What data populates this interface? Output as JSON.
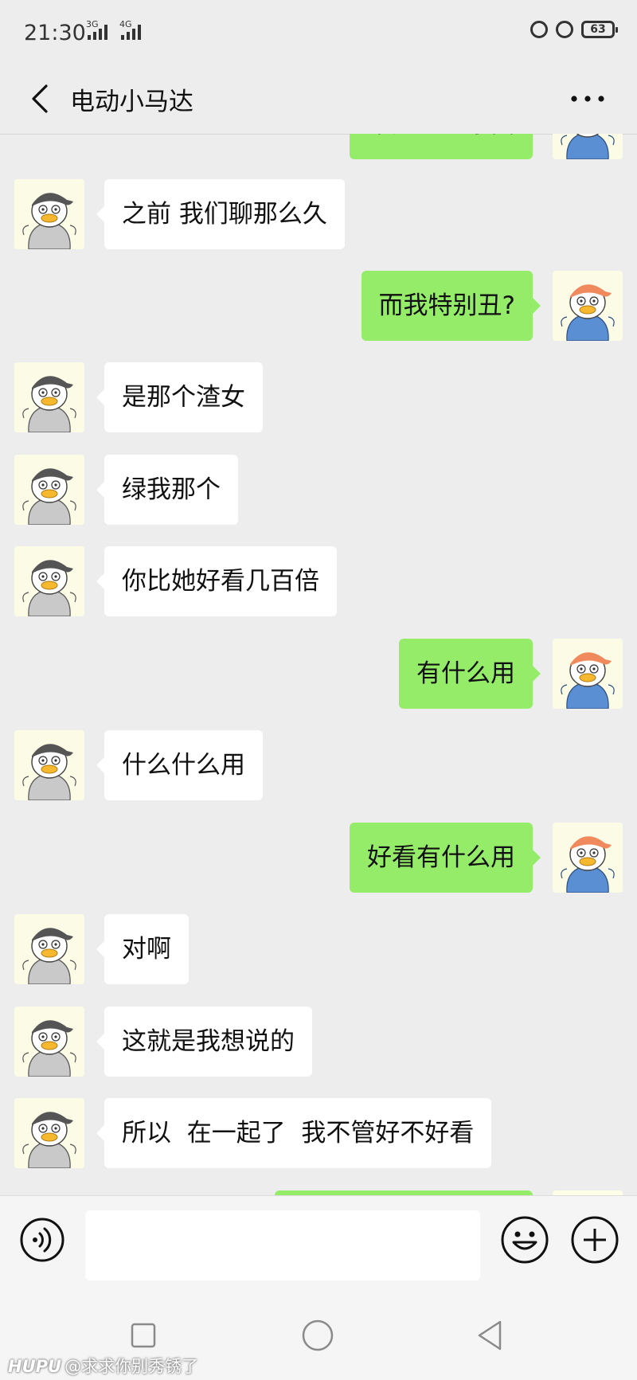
{
  "status_bar": {
    "time": "21:30",
    "network_1": "3G",
    "network_2": "4G",
    "battery": "63"
  },
  "header": {
    "title": "电动小马达"
  },
  "messages": [
    {
      "side": "right",
      "text": "不是一个东西",
      "partial": "top"
    },
    {
      "side": "left",
      "text": "之前 我们聊那么久"
    },
    {
      "side": "right",
      "text": "而我特别丑?"
    },
    {
      "side": "left",
      "text": "是那个渣女"
    },
    {
      "side": "left",
      "text": "绿我那个"
    },
    {
      "side": "left",
      "text": "你比她好看几百倍"
    },
    {
      "side": "right",
      "text": "有什么用"
    },
    {
      "side": "left",
      "text": "什么什么用"
    },
    {
      "side": "right",
      "text": "好看有什么用"
    },
    {
      "side": "left",
      "text": "对啊"
    },
    {
      "side": "left",
      "text": "这就是我想说的"
    },
    {
      "side": "left",
      "text": "所以  在一起了  我不管好不好看"
    },
    {
      "side": "right",
      "text": "",
      "partial": "bottom"
    }
  ],
  "input": {
    "value": "",
    "placeholder": ""
  },
  "watermark": {
    "brand": "HUPU",
    "user": "@求求你别秀锈了"
  },
  "colors": {
    "background": "#ededed",
    "own_bubble": "#95ec69",
    "other_bubble": "#ffffff"
  },
  "icons": {
    "back": "back-arrow-icon",
    "more": "more-dots-icon",
    "voice": "voice-icon",
    "emoji": "emoji-icon",
    "plus": "plus-icon"
  }
}
